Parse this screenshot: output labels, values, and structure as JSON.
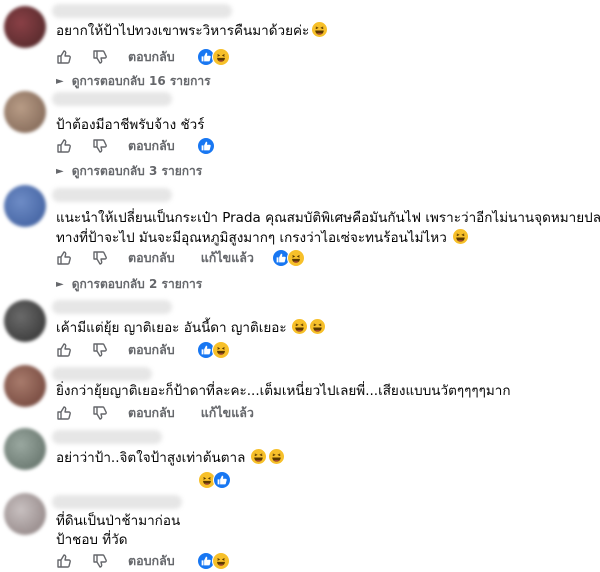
{
  "comments": [
    {
      "text": "อยากให้ป้าไปทวงเขาพระวิหารคืนมาด้วยค่ะ",
      "reply_label": "ตอบกลับ",
      "reactions": [
        "like",
        "haha"
      ],
      "replies_label": "ดูการตอบกลับ 16 รายการ"
    },
    {
      "text": "ป้าต้องมีอาชีพรับจ้าง ชัวร์",
      "reply_label": "ตอบกลับ",
      "reactions": [
        "like"
      ],
      "replies_label": "ดูการตอบกลับ 3 รายการ"
    },
    {
      "text_line1": "แนะนำให้เปลี่ยนเป็นกระเป๋า Prada คุณสมบัติพิเศษคือมันกันไฟ เพราะว่าอีกไม่นานจุดหมายปลาย",
      "text_line2": "ทางที่ป้าจะไป มันจะมีอุณหภูมิสูงมากๆ เกรงว่าไอเซ่จะทนร้อนไม่ไหว",
      "reply_label": "ตอบกลับ",
      "edited_label": "แก้ไขแล้ว",
      "reactions": [
        "like",
        "haha"
      ],
      "replies_label": "ดูการตอบกลับ 2 รายการ"
    },
    {
      "text": "เค้ามีแต่ยุ้ย ญาติเยอะ อันนี้ดา ญาติเยอะ",
      "reply_label": "ตอบกลับ",
      "reactions": [
        "like",
        "haha"
      ]
    },
    {
      "text": "ยิ่งกว่ายุ้ยญาติเยอะก็ป้าดาที่ละคะ...เต็มเหนี่ยวไปเลยพี่...เสียงแบบนวัตๆๆๆๆมาก",
      "reply_label": "ตอบกลับ",
      "edited_label": "แก้ไขแล้ว"
    },
    {
      "text": "อย่าว่าป้า..จิตใจป้าสูงเท่าต้นตาล",
      "reactions": [
        "haha",
        "like"
      ]
    },
    {
      "text_line1": "ที่ดินเป็นป่าช้ามาก่อน",
      "text_line2": "ป้าชอบ ที่วัด",
      "reply_label": "ตอบกลับ",
      "reactions": [
        "like",
        "haha"
      ]
    }
  ],
  "icons": {
    "like_action": "thumbs-up-icon",
    "dislike_action": "thumbs-down-icon",
    "chevron": "chevron-right-icon",
    "like_reaction": "like-reaction-icon",
    "haha_reaction": "haha-reaction-icon"
  },
  "colors": {
    "like_blue": "#1877f2",
    "haha_yellow": "#f7c02a",
    "secondary_text": "#65676b"
  }
}
